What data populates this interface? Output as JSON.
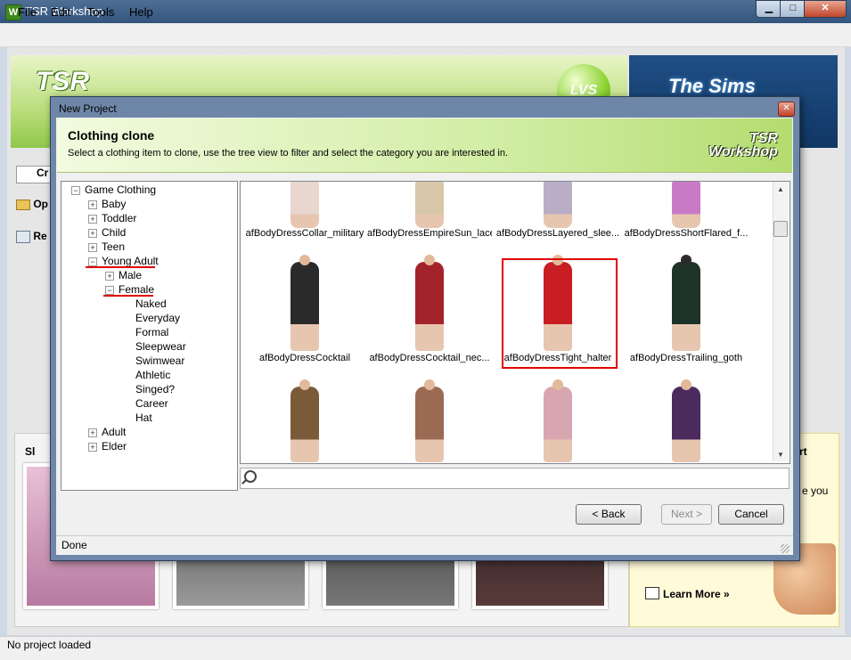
{
  "window": {
    "title": "TSR Workshop",
    "icon_letter": "W",
    "controls": {
      "minimize": "▁",
      "maximize": "□",
      "close": "✕"
    }
  },
  "menu": [
    "File",
    "Edit",
    "Tools",
    "Help"
  ],
  "banner": {
    "logo_text": "TSR",
    "badge_text": "LVS",
    "right_logo_text": "The Sims"
  },
  "side_items": [
    "Cr",
    "Op",
    "Re"
  ],
  "start_label": "Sl",
  "right_ad": {
    "title_frag": "rt",
    "text_frag": "e you",
    "learn_more": "Learn More »"
  },
  "statusbar": {
    "text": "No project loaded"
  },
  "dialog": {
    "title": "New Project",
    "close": "✕",
    "heading": "Clothing clone",
    "subheading": "Select a clothing item to clone, use the tree view to filter and select the category you are interested in.",
    "logo_line1": "TSR",
    "logo_line2": "Workshop",
    "tree": {
      "root": "Game Clothing",
      "nodes": [
        {
          "label": "Baby"
        },
        {
          "label": "Toddler"
        },
        {
          "label": "Child"
        },
        {
          "label": "Teen"
        },
        {
          "label": "Young Adult"
        },
        {
          "label": "Male"
        },
        {
          "label": "Female"
        },
        {
          "label": "Naked"
        },
        {
          "label": "Everyday"
        },
        {
          "label": "Formal"
        },
        {
          "label": "Sleepwear"
        },
        {
          "label": "Swimwear"
        },
        {
          "label": "Athletic"
        },
        {
          "label": "Singed?"
        },
        {
          "label": "Career"
        },
        {
          "label": "Hat"
        },
        {
          "label": "Adult"
        },
        {
          "label": "Elder"
        }
      ]
    },
    "items": [
      {
        "label": "afBodyDressCollar_military",
        "color": "#e8d6cf"
      },
      {
        "label": "afBodyDressEmpireSun_lace",
        "color": "#d8c7a8"
      },
      {
        "label": "afBodyDressLayered_slee...",
        "color": "#b9aec6"
      },
      {
        "label": "afBodyDressShortFlared_f...",
        "color": "#c97ac7"
      },
      {
        "label": "afBodyDressCocktail",
        "color": "#2a2a2a"
      },
      {
        "label": "afBodyDressCocktail_nec...",
        "color": "#a3232b"
      },
      {
        "label": "afBodyDressTight_halter",
        "color": "#c81d22"
      },
      {
        "label": "afBodyDressTrailing_goth",
        "color": "#1d3328"
      },
      {
        "label": "",
        "color": "#7b5a3a"
      },
      {
        "label": "",
        "color": "#9b6a52"
      },
      {
        "label": "",
        "color": "#d7a6b0"
      },
      {
        "label": "",
        "color": "#4b2a5e"
      }
    ],
    "buttons": {
      "back": "< Back",
      "next": "Next >",
      "cancel": "Cancel"
    },
    "status": "Done"
  }
}
